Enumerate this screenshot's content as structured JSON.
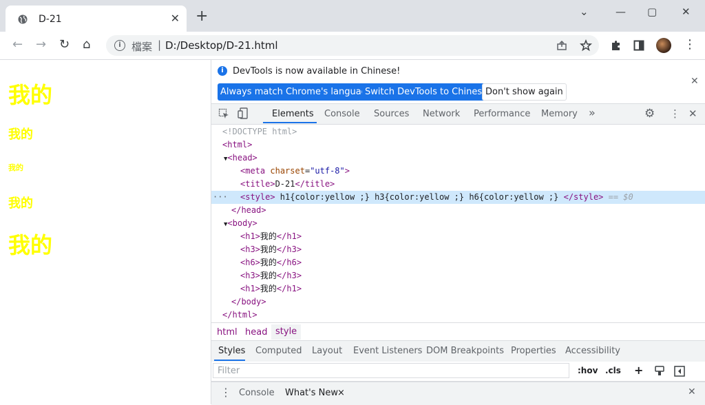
{
  "browser": {
    "tab_title": "D-21",
    "tab_close": "✕",
    "new_tab": "+",
    "window_controls": [
      "⌄",
      "—",
      "▢",
      "✕"
    ],
    "back": "←",
    "forward": "→",
    "reload": "↻",
    "home": "⌂",
    "scheme_label": "檔案",
    "separator": "|",
    "url": "D:/Desktop/D-21.html",
    "icons": [
      "share-icon",
      "star-icon",
      "extensions-icon",
      "side-panel-icon",
      "menu-icon"
    ]
  },
  "page": {
    "lines": [
      "我的",
      "我的",
      "我的",
      "我的",
      "我的"
    ],
    "text_color": "#ffff00"
  },
  "devtools": {
    "infobar": {
      "message": "DevTools is now available in Chinese!",
      "btn_match": "Always match Chrome's language",
      "btn_switch": "Switch DevTools to Chinese",
      "btn_dont_show": "Don't show again"
    },
    "tabs": [
      "Elements",
      "Console",
      "Sources",
      "Network",
      "Performance",
      "Memory"
    ],
    "more_tabs": "»",
    "active_tab": "Elements",
    "dom": {
      "doctype": "<!DOCTYPE html>",
      "html_open": "<html>",
      "head_open": "<head>",
      "meta_tag": "meta",
      "meta_attr": "charset",
      "meta_val": "\"utf-8\"",
      "title_open": "<title>",
      "title_text": "D-21",
      "title_close": "</title>",
      "style_open": "<style>",
      "style_text": " h1{color:yellow ;} h3{color:yellow ;} h6{color:yellow ;} ",
      "style_close": "</style>",
      "sel_marker": " == $0",
      "ellipsis": "···",
      "head_close": "</head>",
      "body_open": "<body>",
      "body_children": [
        {
          "open": "<h1>",
          "text": "我的",
          "close": "</h1>"
        },
        {
          "open": "<h3>",
          "text": "我的",
          "close": "</h3>"
        },
        {
          "open": "<h6>",
          "text": "我的",
          "close": "</h6>"
        },
        {
          "open": "<h3>",
          "text": "我的",
          "close": "</h3>"
        },
        {
          "open": "<h1>",
          "text": "我的",
          "close": "</h1>"
        }
      ],
      "body_close": "</body>",
      "html_close": "</html>"
    },
    "breadcrumbs": [
      "html",
      "head",
      "style"
    ],
    "styles_tabs": [
      "Styles",
      "Computed",
      "Layout",
      "Event Listeners",
      "DOM Breakpoints",
      "Properties",
      "Accessibility"
    ],
    "filter_placeholder": "Filter",
    "hov": ":hov",
    "cls": ".cls",
    "plus": "+",
    "drawer": {
      "console": "Console",
      "whats_new": "What's New",
      "close_x": "×"
    }
  }
}
